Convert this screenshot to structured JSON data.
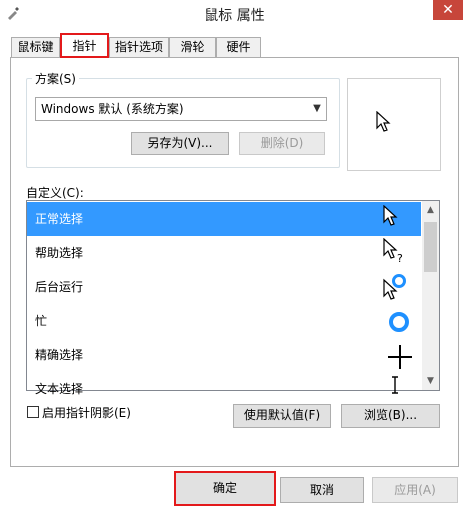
{
  "window": {
    "title": "鼠标 属性",
    "close_glyph": "✕"
  },
  "tabs": [
    {
      "label": "鼠标键"
    },
    {
      "label": "指针"
    },
    {
      "label": "指针选项"
    },
    {
      "label": "滑轮"
    },
    {
      "label": "硬件"
    }
  ],
  "scheme": {
    "label": "方案(S)",
    "selected": "Windows 默认 (系统方案)",
    "save_as_label": "另存为(V)...",
    "delete_label": "删除(D)"
  },
  "customize": {
    "label": "自定义(C):",
    "items": [
      {
        "label": "正常选择",
        "icon": "arrow-cursor"
      },
      {
        "label": "帮助选择",
        "icon": "help-cursor"
      },
      {
        "label": "后台运行",
        "icon": "working-in-background-cursor"
      },
      {
        "label": "忙",
        "icon": "busy-cursor"
      },
      {
        "label": "精确选择",
        "icon": "precision-cursor"
      },
      {
        "label": "文本选择",
        "icon": "text-cursor"
      }
    ]
  },
  "shadow_checkbox": {
    "label": "启用指针阴影(E)",
    "checked": false
  },
  "buttons": {
    "use_default": "使用默认值(F)",
    "browse": "浏览(B)...",
    "ok": "确定",
    "cancel": "取消",
    "apply": "应用(A)"
  },
  "colors": {
    "selection": "#3399ff",
    "highlight_box": "#e3191b",
    "close_button": "#c7463a",
    "busy_ring": "#1e90ff"
  }
}
